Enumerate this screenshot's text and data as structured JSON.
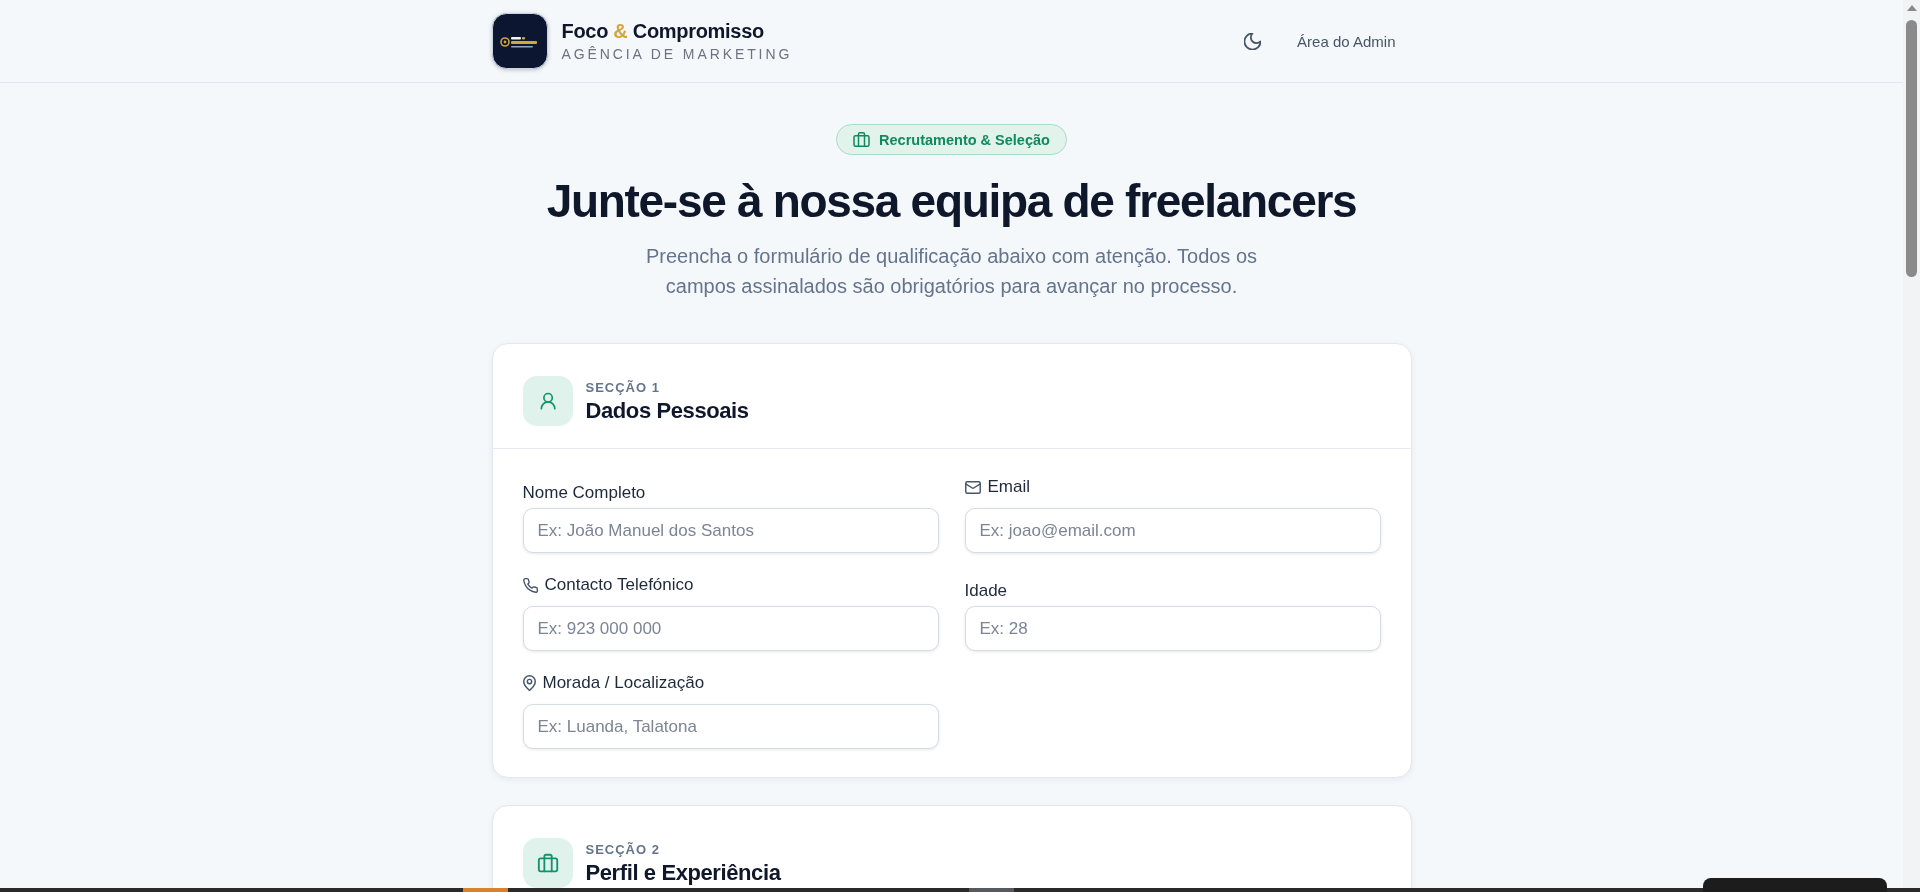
{
  "header": {
    "brand": {
      "name_start": "Foco",
      "connector": "&",
      "name_end": "Compromisso",
      "tagline": "AGÊNCIA DE MARKETING"
    },
    "admin_link": "Área do Admin"
  },
  "hero": {
    "badge": "Recrutamento & Seleção",
    "title": "Junte-se à nossa equipa de freelancers",
    "subtitle": "Preencha o formulário de qualificação abaixo com atenção. Todos os campos assinalados são obrigatórios para avançar no processo."
  },
  "sections": [
    {
      "kind": "personal",
      "number_label": "SECÇÃO 1",
      "title": "Dados Pessoais",
      "fields": [
        {
          "kind": "plain",
          "label": "Nome Completo",
          "placeholder": "Ex: João Manuel dos Santos"
        },
        {
          "kind": "email",
          "label": "Email",
          "placeholder": "Ex: joao@email.com"
        },
        {
          "kind": "phone",
          "label": "Contacto Telefónico",
          "placeholder": "Ex: 923 000 000"
        },
        {
          "kind": "plain",
          "label": "Idade",
          "placeholder": "Ex: 28"
        },
        {
          "kind": "location",
          "label": "Morada / Localização",
          "placeholder": "Ex: Luanda, Talatona"
        }
      ]
    },
    {
      "kind": "profile",
      "number_label": "SECÇÃO 2",
      "title": "Perfil e Experiência"
    }
  ]
}
